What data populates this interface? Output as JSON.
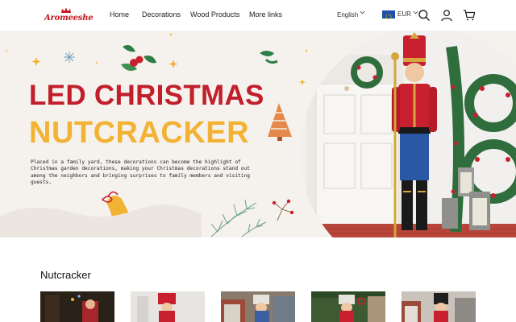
{
  "header": {
    "logo_text": "Aromeeshe",
    "nav": [
      {
        "label": "Home",
        "name": "nav-home"
      },
      {
        "label": "Decorations",
        "name": "nav-decorations"
      },
      {
        "label": "Wood Products",
        "name": "nav-wood-products"
      },
      {
        "label": "More links",
        "name": "nav-more-links"
      }
    ],
    "language": "English",
    "currency": "EUR",
    "icons": [
      "search-icon",
      "account-icon",
      "cart-icon"
    ]
  },
  "hero": {
    "headline_line1": "LED CHRISTMAS",
    "headline_line2": "NUTCRACKER",
    "description": "Placed in a family yard, these decorations can become the highlight of Christmas garden decorations, making your Christmas decorations stand out among the neighbors and bringing surprises to family members and visiting guests.",
    "colors": {
      "headline_red": "#c11f2b",
      "headline_gold": "#f2b233",
      "background": "#f5f2ee"
    }
  },
  "section": {
    "title": "Nutcracker",
    "products": [
      {
        "name": "product-thumb-1"
      },
      {
        "name": "product-thumb-2"
      },
      {
        "name": "product-thumb-3"
      },
      {
        "name": "product-thumb-4"
      },
      {
        "name": "product-thumb-5"
      }
    ]
  }
}
